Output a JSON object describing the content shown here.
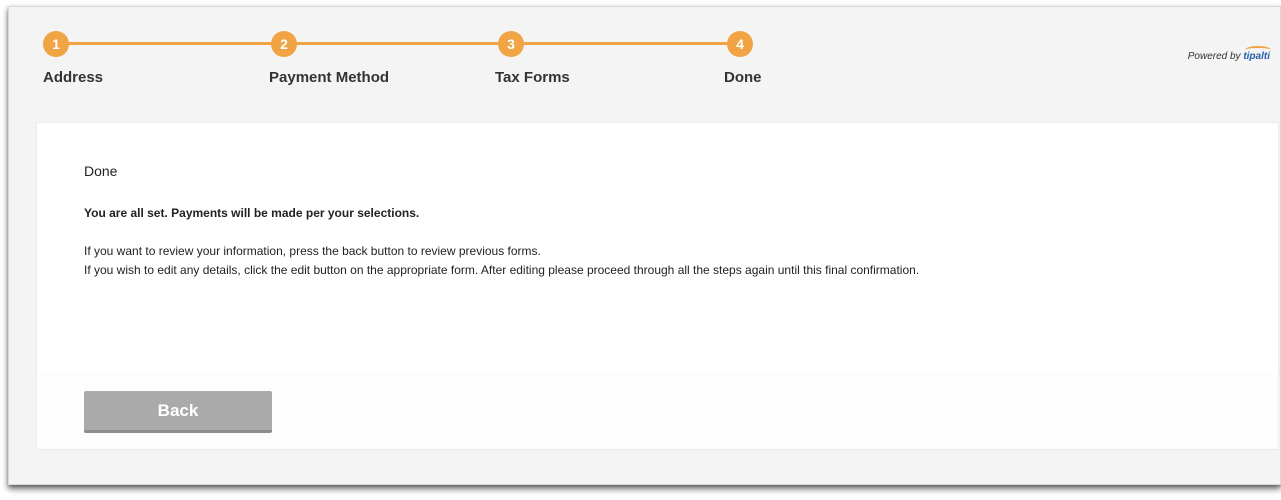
{
  "steps": [
    {
      "number": "1",
      "label": "Address"
    },
    {
      "number": "2",
      "label": "Payment Method"
    },
    {
      "number": "3",
      "label": "Tax Forms"
    },
    {
      "number": "4",
      "label": "Done"
    }
  ],
  "powered_by": {
    "prefix": "Powered by",
    "brand": "tipalti"
  },
  "panel": {
    "title": "Done",
    "subtitle": "You are all set. Payments will be made per your selections.",
    "line1": "If you want to review your information, press the back button to review previous forms.",
    "line2": "If you wish to edit any details, click the edit button on the appropriate form. After editing please proceed through all the steps again until this final confirmation."
  },
  "buttons": {
    "back_label": "Back"
  },
  "colors": {
    "accent": "#f0a444",
    "button": "#aaaaaa",
    "brand": "#1f5fa8"
  }
}
